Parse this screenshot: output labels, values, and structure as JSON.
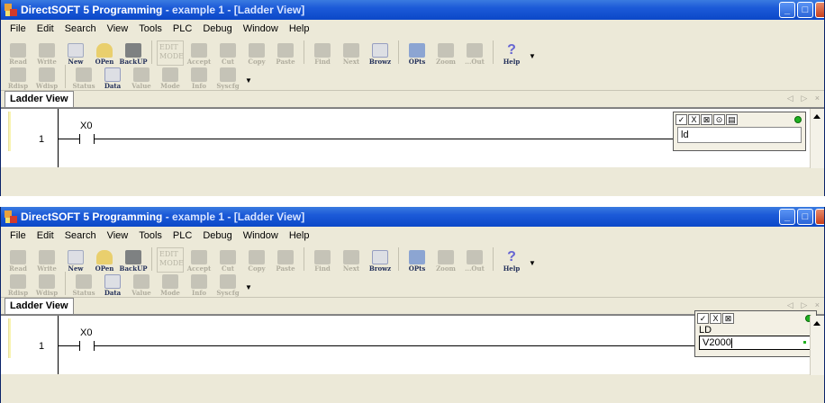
{
  "window": {
    "title_main": "DirectSOFT 5 Programming",
    "title_sep": " - ",
    "title_file": "example 1 - [Ladder View]",
    "min_label": "_",
    "max_label": "□",
    "close_label": "X"
  },
  "menu": [
    "File",
    "Edit",
    "Search",
    "View",
    "Tools",
    "PLC",
    "Debug",
    "Window",
    "Help"
  ],
  "toolbar": {
    "read": "Read",
    "write": "Write",
    "new": "New",
    "open": "OPen",
    "backup": "BackUP",
    "edit_mode": "EDIT MODE",
    "accept": "Accept",
    "cut": "Cut",
    "copy": "Copy",
    "paste": "Paste",
    "find": "Find",
    "next": "Next",
    "browz": "Browz",
    "opts": "OPts",
    "zoom": "Zoom",
    "zoom_out": "...Out",
    "help": "Help"
  },
  "toolbar2": {
    "rdisp": "Rdisp",
    "wdisp": "Wdisp",
    "status": "Status",
    "data": "Data",
    "value": "Value",
    "mode": "Mode",
    "info": "Info",
    "syscfg": "Syscfg"
  },
  "tabs": {
    "ladder_view": "Ladder View",
    "nav": "◁ ▷ ×"
  },
  "ladder": {
    "rung_number": "1",
    "contact_label": "X0"
  },
  "popup1": {
    "buttons": [
      "✓",
      "X",
      "⊠",
      "⊙",
      "▤"
    ],
    "instruction": "ld"
  },
  "popup2": {
    "buttons": [
      "✓",
      "X",
      "⊠"
    ],
    "instruction_label": "LD",
    "operand": "V2000"
  }
}
